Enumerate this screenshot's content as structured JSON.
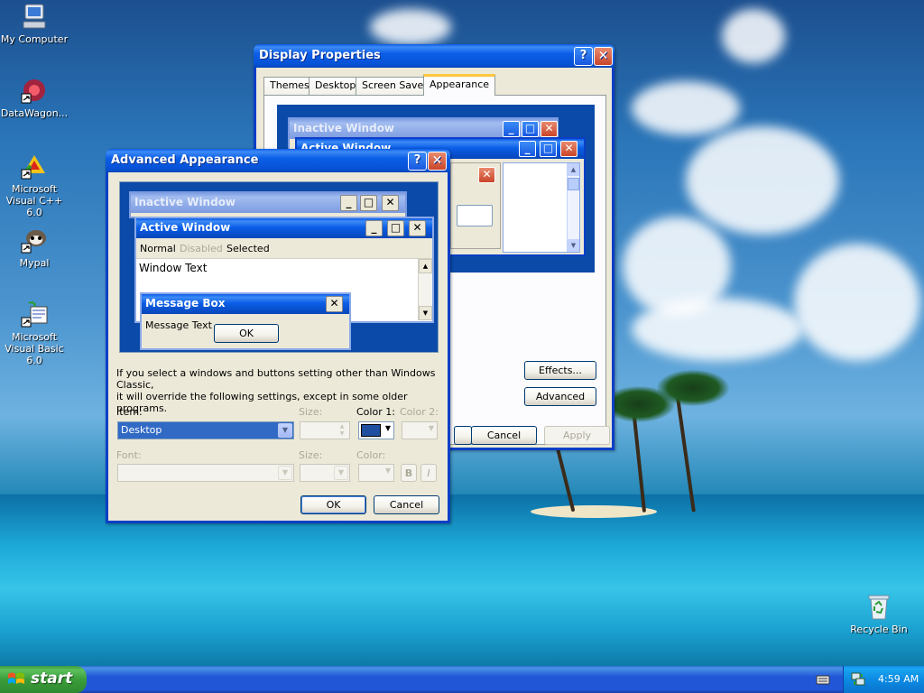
{
  "desktop": {
    "icons": [
      {
        "label": "My Computer"
      },
      {
        "label": "DataWagon..."
      },
      {
        "label": "Microsoft Visual C++ 6.0"
      },
      {
        "label": "Mypal"
      },
      {
        "label": "Microsoft Visual Basic 6.0"
      },
      {
        "label": "Recycle Bin"
      }
    ]
  },
  "display_properties": {
    "title": "Display Properties",
    "tabs": [
      "Themes",
      "Desktop",
      "Screen Saver",
      "Appearance"
    ],
    "selected_tab": "Appearance",
    "preview": {
      "inactive_title": "Inactive Window",
      "active_title": "Active Window"
    },
    "buttons": {
      "effects": "Effects...",
      "advanced": "Advanced",
      "cancel": "Cancel",
      "apply": "Apply"
    }
  },
  "advanced_appearance": {
    "title": "Advanced Appearance",
    "preview": {
      "inactive_title": "Inactive Window",
      "active_title": "Active Window",
      "menu": [
        "Normal",
        "Disabled",
        "Selected"
      ],
      "window_text": "Window Text",
      "msgbox_title": "Message Box",
      "msgbox_text": "Message Text",
      "msgbox_ok": "OK"
    },
    "info_text_1": "If you select a windows and buttons setting other than Windows Classic,",
    "info_text_2": "it will override the following settings, except in some older programs.",
    "labels": {
      "item": "Item:",
      "size": "Size:",
      "color1": "Color 1:",
      "color2": "Color 2:",
      "font": "Font:",
      "font_size": "Size:",
      "font_color": "Color:"
    },
    "item_value": "Desktop",
    "color1_hex": "#1f4fa0",
    "bold_label": "B",
    "italic_label": "I",
    "buttons": {
      "ok": "OK",
      "cancel": "Cancel"
    }
  },
  "taskbar": {
    "start_label": "start",
    "clock": "4:59 AM"
  }
}
